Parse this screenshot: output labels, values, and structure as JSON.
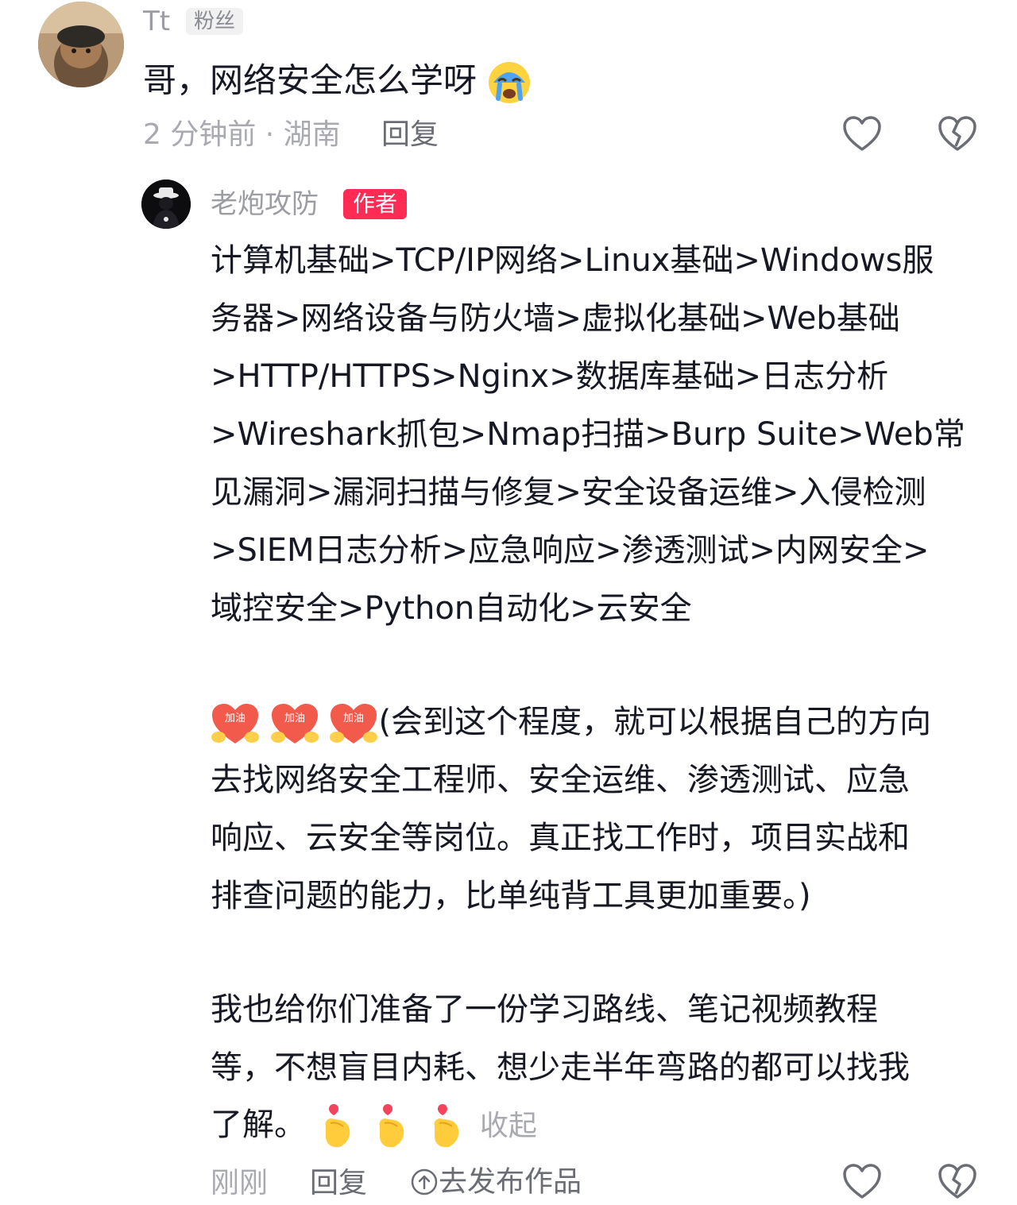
{
  "comment": {
    "username": "Tt",
    "badge": "粉丝",
    "text": "哥，网络安全怎么学呀",
    "emoji": "crying-face-icon",
    "time_location": "2 分钟前 · 湖南",
    "reply_label": "回复",
    "like_icon": "heart-icon",
    "dislike_icon": "broken-heart-icon"
  },
  "reply": {
    "username": "老炮攻防",
    "author_badge": "作者",
    "lines": [
      "计算机基础>TCP/IP网络>Linux基础>Windows服",
      "务器>网络设备与防火墙>虚拟化基础>Web基础",
      ">HTTP/HTTPS>Nginx>数据库基础>日志分析",
      ">Wireshark抓包>Nmap扫描>Burp Suite>Web常",
      "见漏洞>漏洞扫描与修复>安全设备运维>入侵检测",
      ">SIEM日志分析>应急响应>渗透测试>内网安全>",
      "域控安全>Python自动化>云安全"
    ],
    "para2_first": "(会到这个程度，就可以根据自己的方向",
    "para2_lines": [
      "去找网络安全工程师、安全运维、渗透测试、应急",
      "响应、云安全等岗位。真正找工作时，项目实战和",
      "排查问题的能力，比单纯背工具更加重要。)"
    ],
    "para3_lines": [
      "我也给你们准备了一份学习路线、笔记视频教程",
      "等，不想盲目内耗、想少走半年弯路的都可以找我"
    ],
    "para3_last": "了解。",
    "cheer_emoji": "jiayou-emoji-icon",
    "cheer_label": "加油",
    "finger_heart_emoji": "finger-heart-icon",
    "collapse_label": "收起",
    "time": "刚刚",
    "reply_label": "回复",
    "publish_label": "去发布作品",
    "publish_icon": "upload-icon"
  },
  "colors": {
    "author_badge": "#fe2c55",
    "text": "#161823",
    "muted": "#a8aab0"
  }
}
